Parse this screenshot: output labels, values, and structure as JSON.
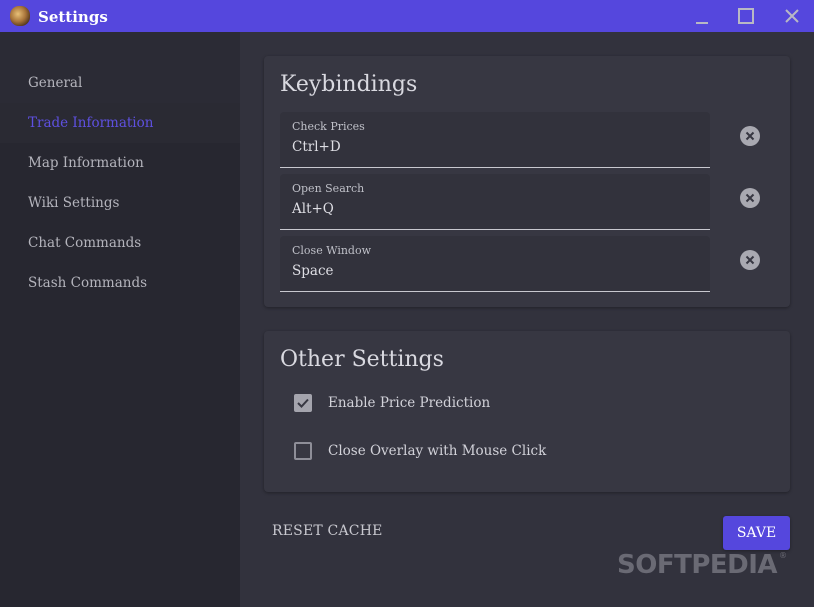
{
  "window": {
    "title": "Settings",
    "controls": {
      "minimize": "minimize-icon",
      "maximize": "maximize-icon",
      "close": "close-icon"
    }
  },
  "sidebar": {
    "items": [
      {
        "label": "General",
        "active": false
      },
      {
        "label": "Trade Information",
        "active": true
      },
      {
        "label": "Map Information",
        "active": false
      },
      {
        "label": "Wiki Settings",
        "active": false
      },
      {
        "label": "Chat Commands",
        "active": false
      },
      {
        "label": "Stash Commands",
        "active": false
      }
    ]
  },
  "keybindings": {
    "title": "Keybindings",
    "fields": [
      {
        "label": "Check Prices",
        "value": "Ctrl+D"
      },
      {
        "label": "Open Search",
        "value": "Alt+Q"
      },
      {
        "label": "Close Window",
        "value": "Space"
      }
    ]
  },
  "other_settings": {
    "title": "Other Settings",
    "options": [
      {
        "label": "Enable Price Prediction",
        "checked": true
      },
      {
        "label": "Close Overlay with Mouse Click",
        "checked": false
      }
    ]
  },
  "actions": {
    "reset_label": "RESET CACHE",
    "save_label": "SAVE"
  },
  "watermark": {
    "text": "SOFTPEDIA",
    "mark": "®"
  },
  "colors": {
    "accent": "#5547dd",
    "sidebar_bg": "#272730",
    "main_bg": "#32323d",
    "card_bg": "#373742"
  }
}
